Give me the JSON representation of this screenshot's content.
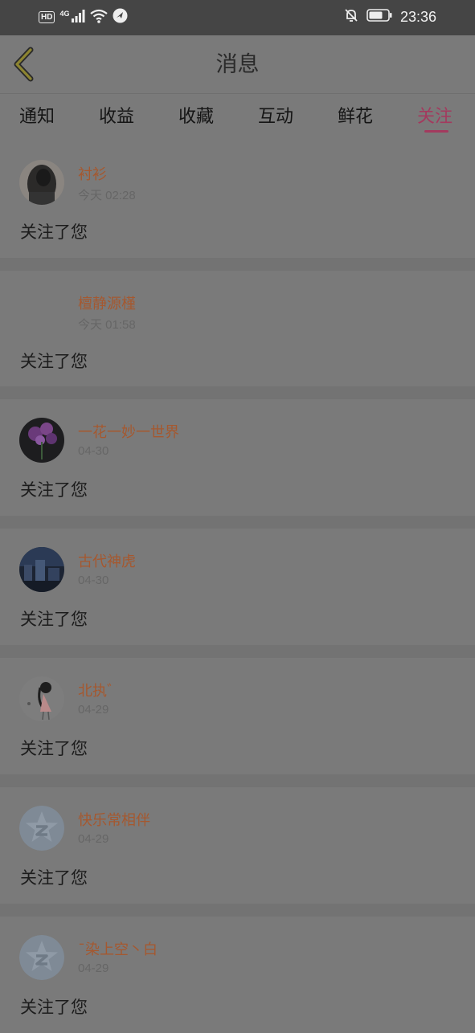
{
  "status_bar": {
    "hd_label": "HD",
    "network_label": "4G",
    "time": "23:36",
    "icons": [
      "signal-icon",
      "wifi-icon",
      "app-notification-icon",
      "silent-bell-icon",
      "battery-icon"
    ]
  },
  "header": {
    "title": "消息",
    "back_icon": "back-chevron-icon"
  },
  "tabs": [
    {
      "label": "通知",
      "active": false
    },
    {
      "label": "收益",
      "active": false
    },
    {
      "label": "收藏",
      "active": false
    },
    {
      "label": "互动",
      "active": false
    },
    {
      "label": "鲜花",
      "active": false
    },
    {
      "label": "关注",
      "active": true
    }
  ],
  "colors": {
    "accent": "#a33a5e",
    "username": "#a5582f",
    "background_dimmed": "#7a7a7a"
  },
  "followers": [
    {
      "name": "衬衫",
      "time": "今天 02:28",
      "message": "关注了您",
      "avatar": "dark-figure-avatar"
    },
    {
      "name": "檀静源槿",
      "time": "今天 01:58",
      "message": "关注了您",
      "avatar": "none"
    },
    {
      "name": "一花一妙一世界",
      "time": "04-30",
      "message": "关注了您",
      "avatar": "purple-flower-avatar"
    },
    {
      "name": "古代神虎",
      "time": "04-30",
      "message": "关注了您",
      "avatar": "night-city-avatar"
    },
    {
      "name": "北执゛",
      "time": "04-29",
      "message": "关注了您",
      "avatar": "anime-girl-avatar"
    },
    {
      "name": "快乐常相伴",
      "time": "04-29",
      "message": "关注了您",
      "avatar": "default-star-avatar"
    },
    {
      "name": "ˉ染上空丶白",
      "time": "04-29",
      "message": "关注了您",
      "avatar": "default-star-avatar"
    }
  ]
}
